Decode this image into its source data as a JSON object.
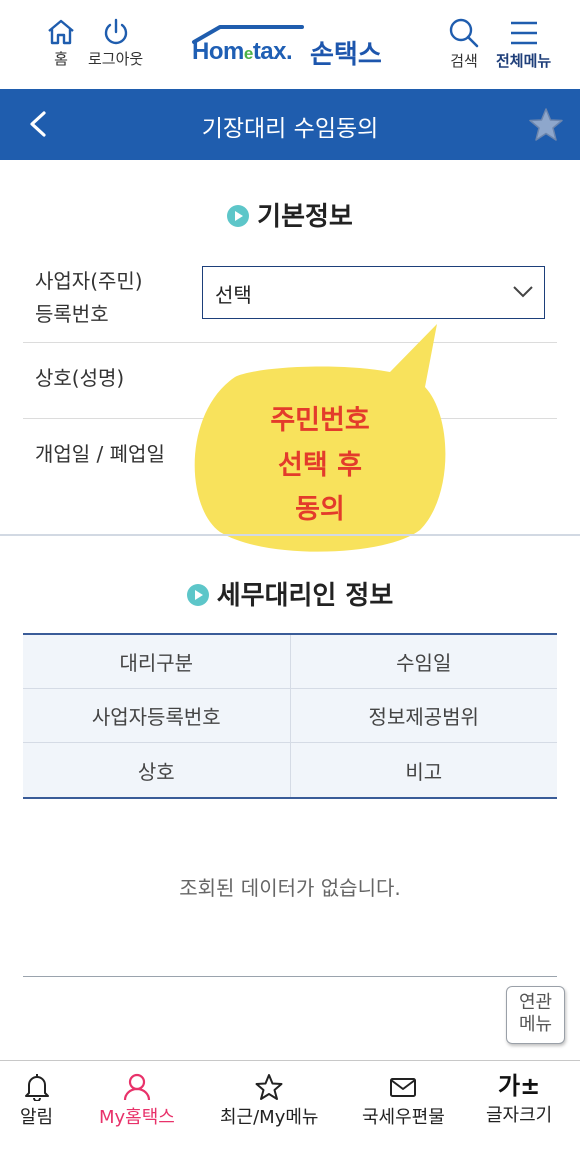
{
  "header": {
    "home_label": "홈",
    "logout_label": "로그아웃",
    "logo_brand_pre": "Hom",
    "logo_brand_e": "e",
    "logo_brand_post": "tax.",
    "logo_korean": "손택스",
    "search_label": "검색",
    "menu_label": "전체메뉴"
  },
  "titlebar": {
    "title": "기장대리 수임동의",
    "color": "#1f5dae"
  },
  "basic_info": {
    "section_title": "기본정보",
    "business_number_label_line1": "사업자(주민)",
    "business_number_label_line2": "등록번호",
    "business_number_select_value": "선택",
    "company_name_label": "상호(성명)",
    "open_close_date_label": "개업일 / 폐업일"
  },
  "callout": {
    "line1": "주민번호",
    "line2": "선택 후",
    "line3": "동의",
    "bubble_color": "#f8e25c",
    "text_color": "#e33b2b"
  },
  "agent_info": {
    "section_title": "세무대리인 정보",
    "table": [
      [
        "대리구분",
        "수임일"
      ],
      [
        "사업자등록번호",
        "정보제공범위"
      ],
      [
        "상호",
        "비고"
      ]
    ],
    "empty_message": "조회된 데이터가 없습니다."
  },
  "related_menu": {
    "line1": "연관",
    "line2": "메뉴"
  },
  "bottom_nav": {
    "items": [
      {
        "label": "알림"
      },
      {
        "label": "My홈택스"
      },
      {
        "label": "최근/My메뉴"
      },
      {
        "label": "국세우편물"
      },
      {
        "label": "글자크기",
        "glyph": "가±"
      }
    ],
    "active_color": "#e8326a"
  }
}
